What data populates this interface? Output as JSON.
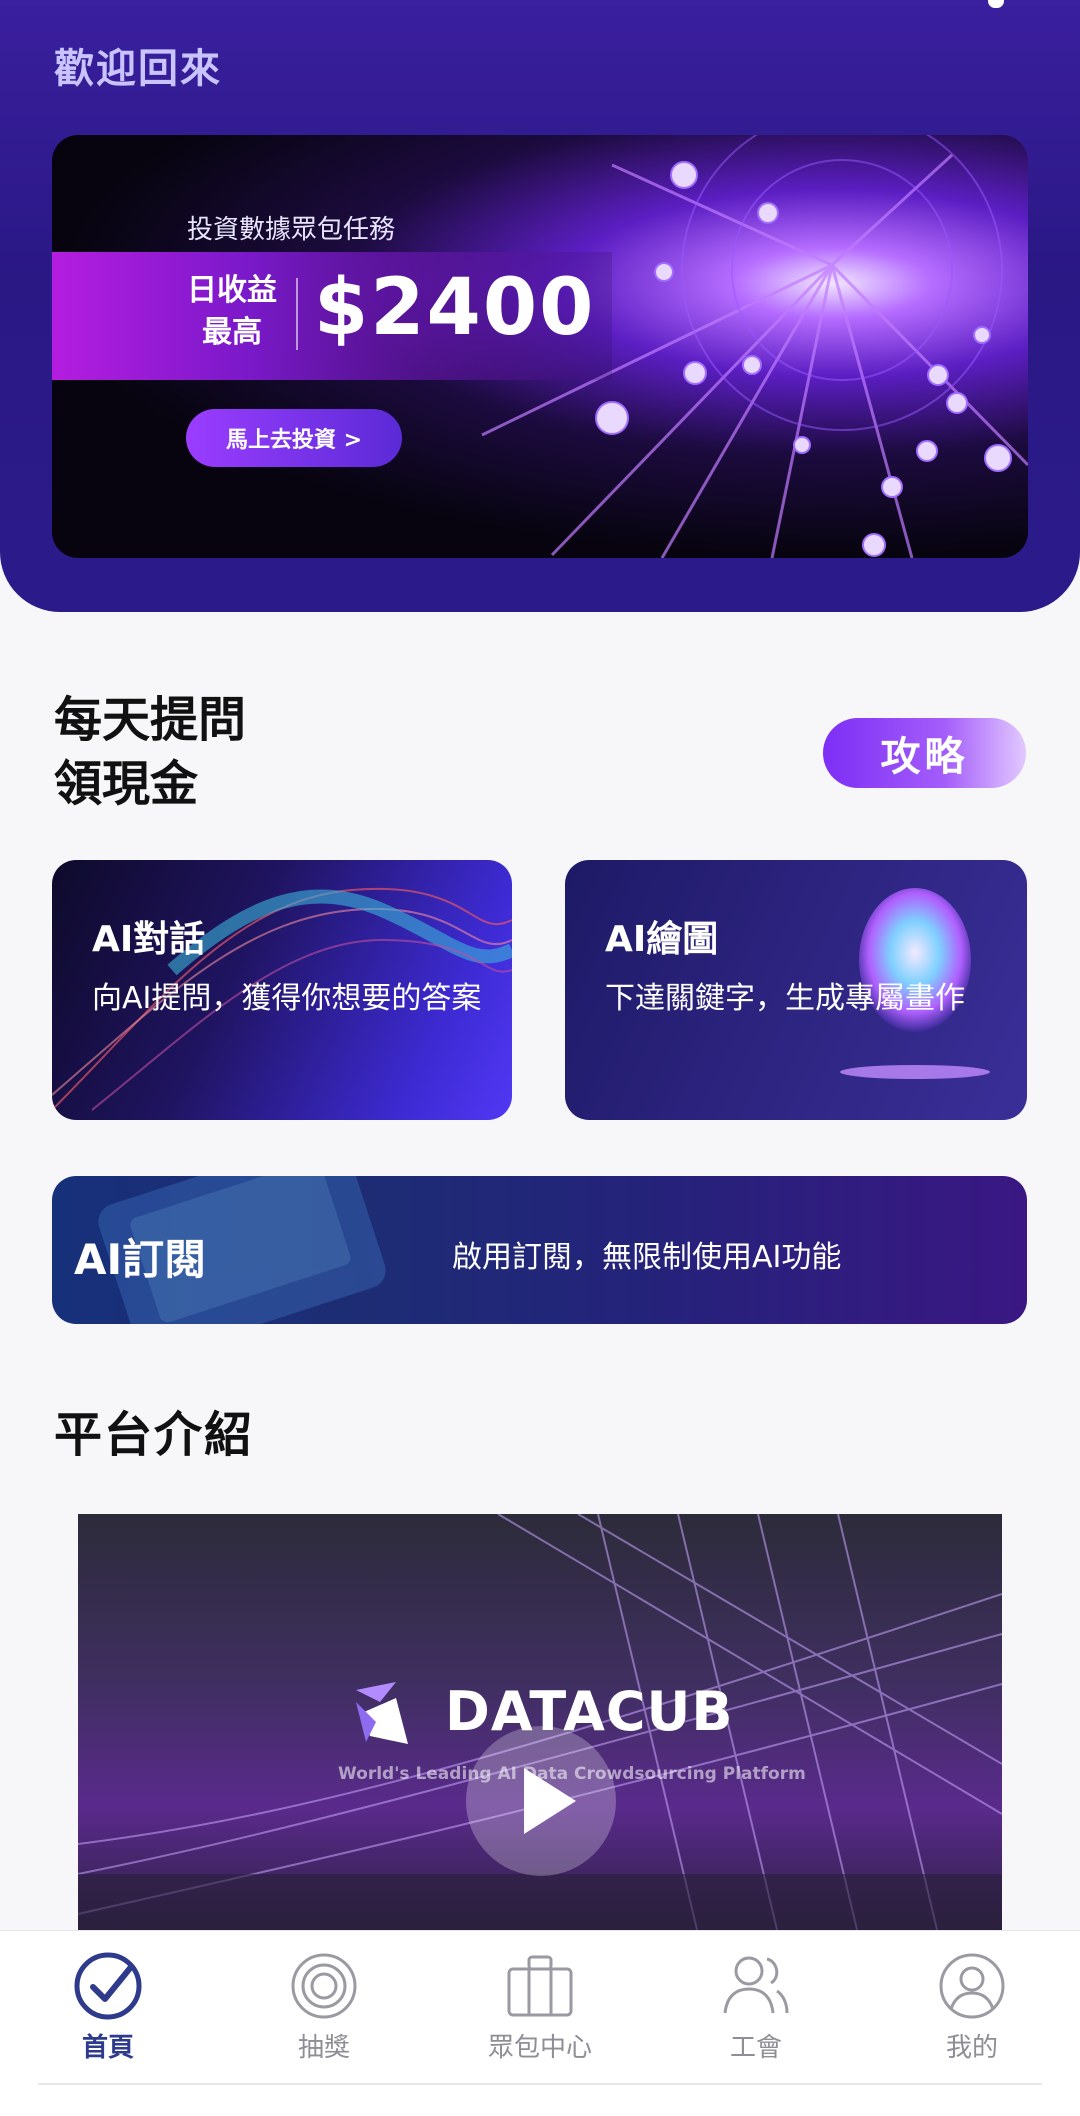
{
  "header": {
    "welcome": "歡迎回來"
  },
  "banner": {
    "tag": "投資數據眾包任務",
    "daily_label": "日收益最高",
    "amount": "$2400",
    "cta": "馬上去投資 >"
  },
  "section": {
    "title": "每天提問領現金",
    "guide_label": "攻略"
  },
  "cards": [
    {
      "title": "AI對話",
      "desc": "向AI提問，獲得你想要的答案"
    },
    {
      "title": "AI繪圖",
      "desc": "下達關鍵字，生成專屬畫作"
    }
  ],
  "subscribe": {
    "title": "AI訂閱",
    "desc": "啟用訂閱，無限制使用AI功能"
  },
  "intro": {
    "title": "平台介紹",
    "video_logo": "DATACUB",
    "video_tagline": "World's Leading AI Data Crowdsourcing Platform"
  },
  "tabs": [
    {
      "label": "首頁",
      "icon": "check-circle-icon",
      "active": true
    },
    {
      "label": "抽獎",
      "icon": "target-icon",
      "active": false
    },
    {
      "label": "眾包中心",
      "icon": "briefcase-icon",
      "active": false
    },
    {
      "label": "工會",
      "icon": "users-icon",
      "active": false
    },
    {
      "label": "我的",
      "icon": "user-icon",
      "active": false
    }
  ],
  "colors": {
    "brand": "#2e3a8c",
    "accent": "#8a3dff",
    "hero": "#2a1885"
  }
}
